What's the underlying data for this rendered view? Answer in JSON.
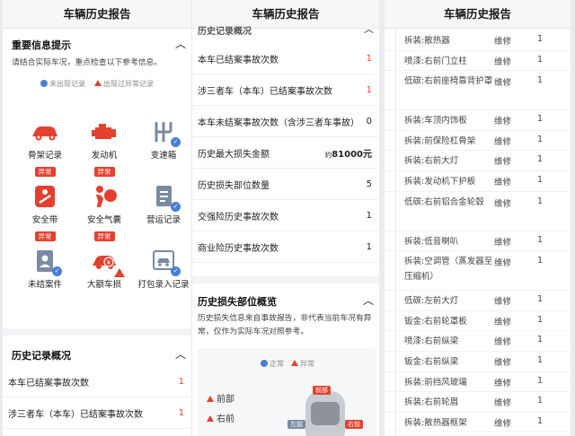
{
  "panel1": {
    "header_title": "车辆历史报告",
    "section_title": "重要信息提示",
    "notice": "请结合实际车况，重点检查以下参考信息。",
    "legend_normal": "未出现记录",
    "legend_abnormal": "出现过异常记录",
    "items": [
      {
        "label": "骨架记录",
        "badge": "异常",
        "status": "abnormal"
      },
      {
        "label": "发动机",
        "badge": "异常",
        "status": "abnormal"
      },
      {
        "label": "变速箱",
        "badge": "",
        "status": "normal"
      },
      {
        "label": "安全带",
        "badge": "异常",
        "status": "abnormal"
      },
      {
        "label": "安全气囊",
        "badge": "异常",
        "status": "abnormal"
      },
      {
        "label": "营运记录",
        "badge": "",
        "status": "normal"
      },
      {
        "label": "未结案件",
        "badge": "",
        "status": "normal"
      },
      {
        "label": "大额车损",
        "badge": "",
        "status": "warning"
      },
      {
        "label": "打包录入记录",
        "badge": "",
        "status": "normal"
      }
    ],
    "history_title": "历史记录概况",
    "rows": [
      {
        "label": "本车已结案事故次数",
        "value": "1"
      },
      {
        "label": "涉三者车（本车）已结案事故次数",
        "value": "1"
      }
    ]
  },
  "panel2": {
    "header_title": "车辆历史报告",
    "partial_section": "历史记录概况",
    "rows": [
      {
        "label": "本车已结案事故次数",
        "value": "1"
      },
      {
        "label": "涉三者车（本车）已结案事故次数",
        "value": "1"
      },
      {
        "label": "本车未结案事故次数（含涉三者车事故）",
        "value": "0"
      },
      {
        "label": "历史最大损失金额",
        "value_prefix": "约",
        "value": "81000元"
      },
      {
        "label": "历史损失部位数量",
        "value": "5"
      },
      {
        "label": "交强险历史事故次数",
        "value": "1"
      },
      {
        "label": "商业险历史事故次数",
        "value": "1"
      }
    ],
    "damage_title": "历史损失部位概览",
    "damage_note": "历史损失信息来自事故报告，非代表当前车况有异常，仅作为实际车况对照参考。",
    "legend_normal": "正常",
    "legend_abnormal": "异常",
    "front_label": "前部",
    "right_front_label": "右前",
    "car_tags": [
      "前部",
      "左前",
      "右前"
    ]
  },
  "panel3": {
    "header_title": "车辆历史报告",
    "items": [
      {
        "part": "拆装:散热器",
        "type": "维修",
        "count": "1"
      },
      {
        "part": "喷漆:右前门立柱",
        "type": "维修",
        "count": "1"
      },
      {
        "part": "低碳:右前座椅靠背护罩",
        "type": "维修",
        "count": "1"
      },
      {
        "part": "拆装:车顶内饰板",
        "type": "维修",
        "count": "1"
      },
      {
        "part": "拆装:前保险杠骨架",
        "type": "维修",
        "count": "1"
      },
      {
        "part": "拆装:右前大灯",
        "type": "维修",
        "count": "1"
      },
      {
        "part": "拆装:发动机下护板",
        "type": "维修",
        "count": "1"
      },
      {
        "part": "低碳:右前铝合金轮毂",
        "type": "维修",
        "count": "1"
      },
      {
        "part": "拆装:低音喇叭",
        "type": "维修",
        "count": "1"
      },
      {
        "part": "拆装:空调管（蒸发器至压缩机）",
        "type": "维修",
        "count": "1"
      },
      {
        "part": "低碳:左前大灯",
        "type": "维修",
        "count": "1"
      },
      {
        "part": "钣金:右前轮罩板",
        "type": "维修",
        "count": "1"
      },
      {
        "part": "喷漆:右前纵梁",
        "type": "维修",
        "count": "1"
      },
      {
        "part": "钣金:右前纵梁",
        "type": "维修",
        "count": "1"
      },
      {
        "part": "拆装:前挡风玻璃",
        "type": "维修",
        "count": "1"
      },
      {
        "part": "拆装:右前轮眉",
        "type": "维修",
        "count": "1"
      },
      {
        "part": "拆装:散热器框架",
        "type": "维修",
        "count": "1"
      }
    ]
  },
  "colors": {
    "accent_red": "#e5402f",
    "check_blue": "#4a7fd6"
  }
}
